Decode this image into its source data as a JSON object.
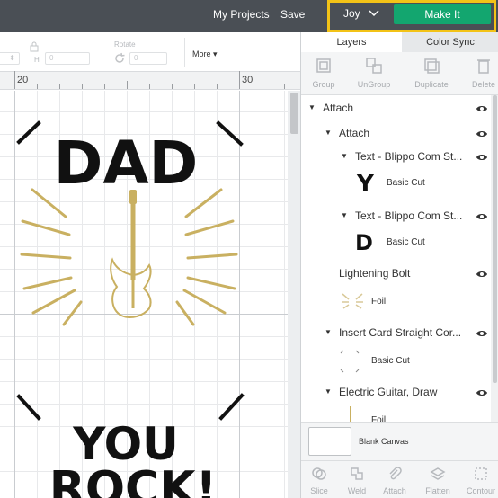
{
  "topbar": {
    "my_projects": "My Projects",
    "save": "Save",
    "separator": "|",
    "machine": "Joy",
    "make_it": "Make It",
    "highlight_color": "#f3c317",
    "make_it_color": "#13a66f"
  },
  "toolbar": {
    "h_label": "H",
    "h_value": "0",
    "rotate_label": "Rotate",
    "rotate_value": "0",
    "more": "More"
  },
  "ruler": {
    "marks": [
      "20",
      "30"
    ]
  },
  "canvas": {
    "design_top": "DAD",
    "design_bottom_1": "YOU",
    "design_bottom_2": "ROCK!",
    "foil_color": "#c9b061"
  },
  "panel": {
    "tabs": [
      "Layers",
      "Color Sync"
    ],
    "actions": [
      "Group",
      "UnGroup",
      "Duplicate",
      "Delete"
    ],
    "layers": [
      {
        "title": "Attach"
      },
      {
        "title": "Attach"
      },
      {
        "title": "Text - Blippo Com St...",
        "operation": "Basic Cut",
        "thumb": "Y"
      },
      {
        "title": "Text - Blippo Com St...",
        "operation": "Basic Cut",
        "thumb": "D"
      },
      {
        "title": "Lightening Bolt",
        "operation": "Foil"
      },
      {
        "title": "Insert Card Straight Cor...",
        "operation": "Basic Cut"
      },
      {
        "title": "Electric Guitar, Draw",
        "operation": "Foil"
      }
    ],
    "blank_canvas": "Blank Canvas",
    "bottom_tools": [
      "Slice",
      "Weld",
      "Attach",
      "Flatten",
      "Contour"
    ]
  }
}
